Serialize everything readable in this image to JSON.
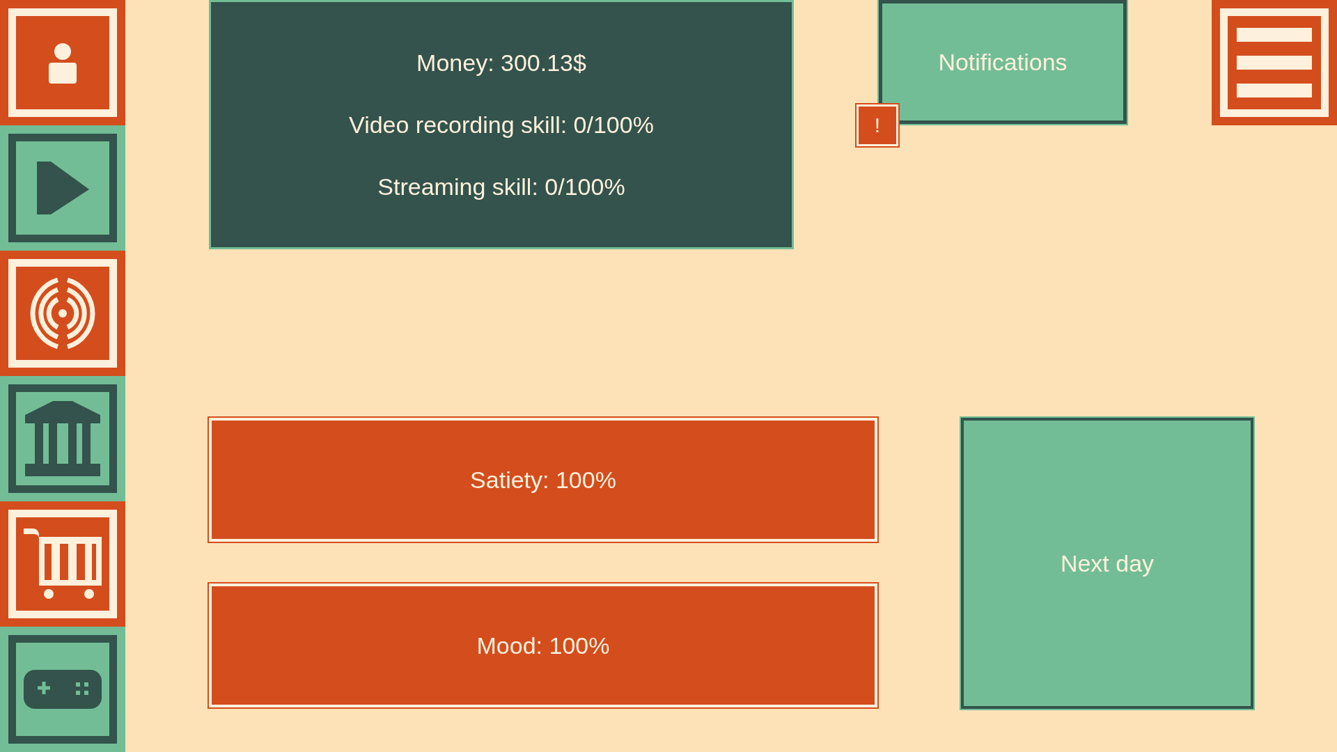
{
  "sidebar": {
    "items": [
      {
        "kind": "profile"
      },
      {
        "kind": "videos"
      },
      {
        "kind": "streaming"
      },
      {
        "kind": "bank"
      },
      {
        "kind": "shop"
      },
      {
        "kind": "games"
      }
    ]
  },
  "stats": [
    "Money: 300.13$",
    "Video recording skill: 0/100%",
    "Streaming skill: 0/100%"
  ],
  "notifications": {
    "label": "Notifications",
    "badge": "!"
  },
  "needs": [
    "Satiety: 100%",
    "Mood: 100%"
  ],
  "next_day": {
    "label": "Next day"
  }
}
